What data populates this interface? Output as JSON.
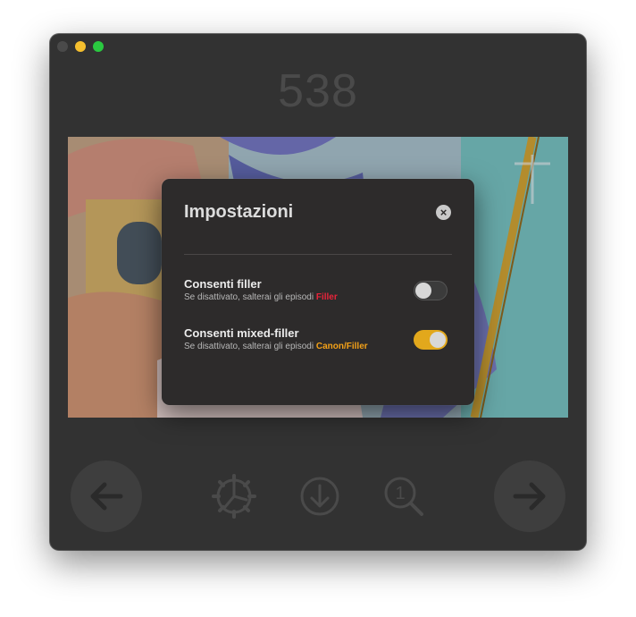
{
  "window": {
    "episode_number": "538"
  },
  "colors": {
    "accent_toggle": "#e2a81c",
    "filler": "#e8243a",
    "canon_filler": "#f3a118"
  },
  "toolbar": {
    "prev_icon": "arrow-left-icon",
    "settings_icon": "gear-icon",
    "download_icon": "download-icon",
    "jump_icon": "search-number-icon",
    "jump_icon_digit": "1",
    "next_icon": "arrow-right-icon"
  },
  "dialog": {
    "title": "Impostazioni",
    "close_icon": "close-icon",
    "settings": [
      {
        "title": "Consenti filler",
        "desc_prefix": "Se disattivato, salterai gli episodi ",
        "desc_highlight": "Filler",
        "enabled": false
      },
      {
        "title": "Consenti mixed-filler",
        "desc_prefix": "Se disattivato, salterai gli episodi ",
        "desc_highlight": "Canon/Filler",
        "enabled": true
      }
    ]
  }
}
